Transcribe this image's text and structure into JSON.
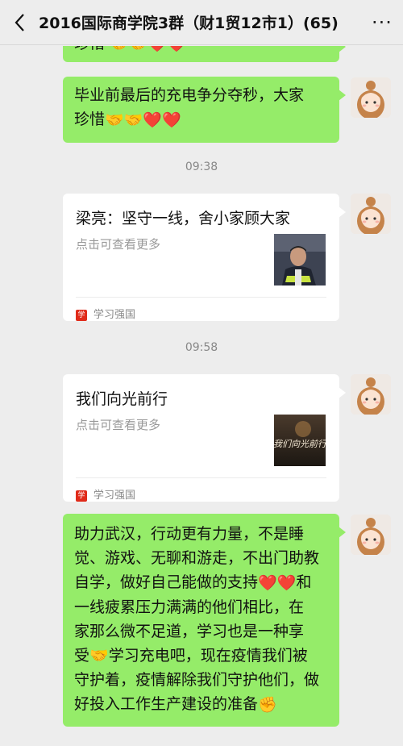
{
  "header": {
    "back_icon": "chevron-left-icon",
    "title": "2016国际商学院3群（财1贸12市1）(65)",
    "more_label": "···"
  },
  "messages": {
    "partial_top_text": "珍惜",
    "msg1": {
      "line1": "毕业前最后的充电争分夺秒，大家",
      "line2": "珍惜"
    },
    "time1": "09:38",
    "card1": {
      "title": "梁亮：坚守一线，舍小家顾大家",
      "desc": "点击可查看更多",
      "source": "学习强国"
    },
    "time2": "09:58",
    "card2": {
      "title": "我们向光前行",
      "desc": "点击可查看更多",
      "source": "学习强国",
      "thumb_text": "我们向光前行"
    },
    "msg2": {
      "lines": [
        "助力武汉，行动更有力量，不是睡",
        "觉、游戏、无聊和游走，不出门助教",
        "自学，做好自己能做的支持",
        "一线疲累压力满满的他们相比，在",
        "家那么微不足道，学习也是一种享",
        "受",
        "守护着，疫情解除我们守护他们，做",
        "好投入工作生产建设的准备"
      ],
      "line3_tail": "和",
      "line6_tail": "学习充电吧，现在疫情我们被"
    }
  },
  "colors": {
    "bubble_green": "#95ec69",
    "heart": "#f25a2a",
    "source_icon": "#e02b1a"
  }
}
